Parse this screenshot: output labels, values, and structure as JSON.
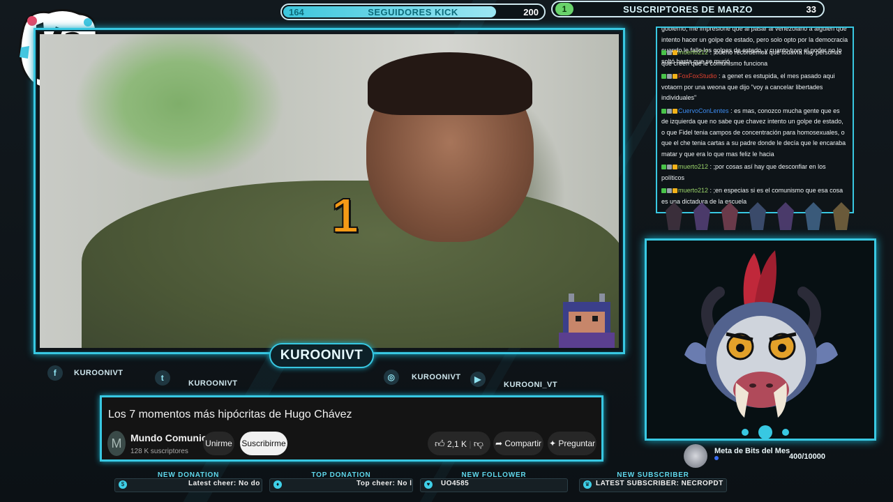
{
  "followers_goal": {
    "current": "164",
    "label": "SEGUIDORES KICK",
    "target": "200",
    "progress": 0.82
  },
  "subs_goal": {
    "current": "1",
    "label": "SUSCRIPTORES DE MARZO",
    "target": "33",
    "progress": 0.03
  },
  "video": {
    "overlay_number": "1"
  },
  "channel_tag": "KUROONIVT",
  "socials": [
    {
      "icon": "facebook-icon",
      "glyph": "f",
      "name": "KUROONIVT"
    },
    {
      "icon": "twitter-icon",
      "glyph": "t",
      "name": "KUROONIVT"
    },
    {
      "icon": "instagram-icon",
      "glyph": "◎",
      "name": "KUROONIVT"
    },
    {
      "icon": "youtube-icon",
      "glyph": "▶",
      "name": "KUROONI_VT"
    }
  ],
  "youtube": {
    "title": "Los 7 momentos más hipócritas de Hugo Chávez",
    "avatar_letter": "M",
    "channel": "Mundo Comunica",
    "verified": "✔",
    "subscribers": "128 K suscriptores",
    "join": "Unirme",
    "subscribe": "Suscribirme",
    "likes": "2,1 K",
    "share": "Compartir",
    "ask": "Preguntar"
  },
  "ticker": [
    {
      "header": "NEW DONATION",
      "text": "Latest cheer: No do"
    },
    {
      "header": "TOP DONATION",
      "text": "Top cheer: No l"
    },
    {
      "header": "NEW FOLLOWER",
      "text": "UO4585"
    },
    {
      "header": "NEW SUBSCRIBER",
      "text": "LATEST SUBSCRIBER: NECROPDT"
    }
  ],
  "chat": {
    "top_text": "gobierno, me impresione que al pasar al venezolano a alguien que intento hacer un golpe de estado, pero solo opto por la democracia cuando le fallo los golpes de estado, y cuanto tuvo el poder no lo soltó hasta que se murió",
    "messages": [
      {
        "user": "muerto212",
        "color": "#9ad36a",
        "text": ": ;bueno recordemos que todavía hay personas que creen que le comunismo funciona"
      },
      {
        "user": "FoxFoxStudio",
        "color": "#e0402e",
        "text": ": a genet es estupida, el mes pasado aqui votaorn por una weona que dijo \"voy a cancelar libertades individuales\""
      },
      {
        "user": "CuervoConLentes",
        "color": "#3d8cf0",
        "text": ": es mas, conozco mucha gente que es de izquierda que no sabe que chavez intento un golpe de estado, o que Fidel tenia campos de concentración para homosexuales, o que el che tenia cartas a su padre donde le decía que le encaraba matar y que era lo que mas feliz le hacia"
      },
      {
        "user": "muerto212",
        "color": "#9ad36a",
        "text": ": ;por cosas así hay que desconfiar en los políticos"
      },
      {
        "user": "muerto212",
        "color": "#9ad36a",
        "text": ": ;en especias si es el comunismo que esa cosa es una dictadura de la escuela"
      }
    ]
  },
  "bits_goal": {
    "label": "Meta de Bits del Mes",
    "progress": "400/10000"
  }
}
